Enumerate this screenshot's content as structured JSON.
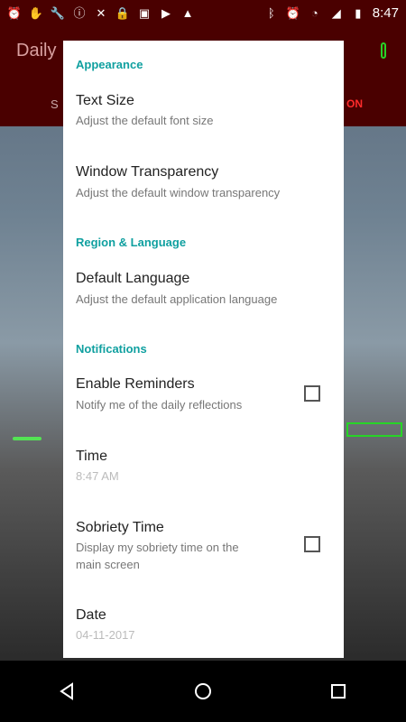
{
  "status": {
    "time": "8:47",
    "left_icons": [
      "alarm-icon",
      "hand-icon",
      "wrench-icon",
      "warning-icon",
      "satellite-off-icon",
      "lock-icon",
      "photo-icon",
      "play-icon",
      "android-icon"
    ],
    "right_icons": [
      "bluetooth-icon",
      "alarm-icon",
      "wifi-icon",
      "cellular-icon",
      "battery-icon"
    ]
  },
  "background": {
    "app_title": "Daily",
    "side_label": "S",
    "toggle_label": "ON"
  },
  "settings": {
    "appearance": {
      "header": "Appearance",
      "text_size_title": "Text Size",
      "text_size_sub": "Adjust the default font size",
      "transparency_title": "Window Transparency",
      "transparency_sub": "Adjust the default window transparency"
    },
    "region": {
      "header": "Region & Language",
      "language_title": "Default Language",
      "language_sub": "Adjust the default application language"
    },
    "notifications": {
      "header": "Notifications",
      "reminders_title": "Enable Reminders",
      "reminders_sub": "Notify me of the daily reflections",
      "time_title": "Time",
      "time_value": "8:47 AM",
      "sobriety_title": "Sobriety Time",
      "sobriety_sub_line1": "Display my sobriety time on the",
      "sobriety_sub_line2": "main screen",
      "date_title": "Date",
      "date_value": "04-11-2017"
    }
  }
}
